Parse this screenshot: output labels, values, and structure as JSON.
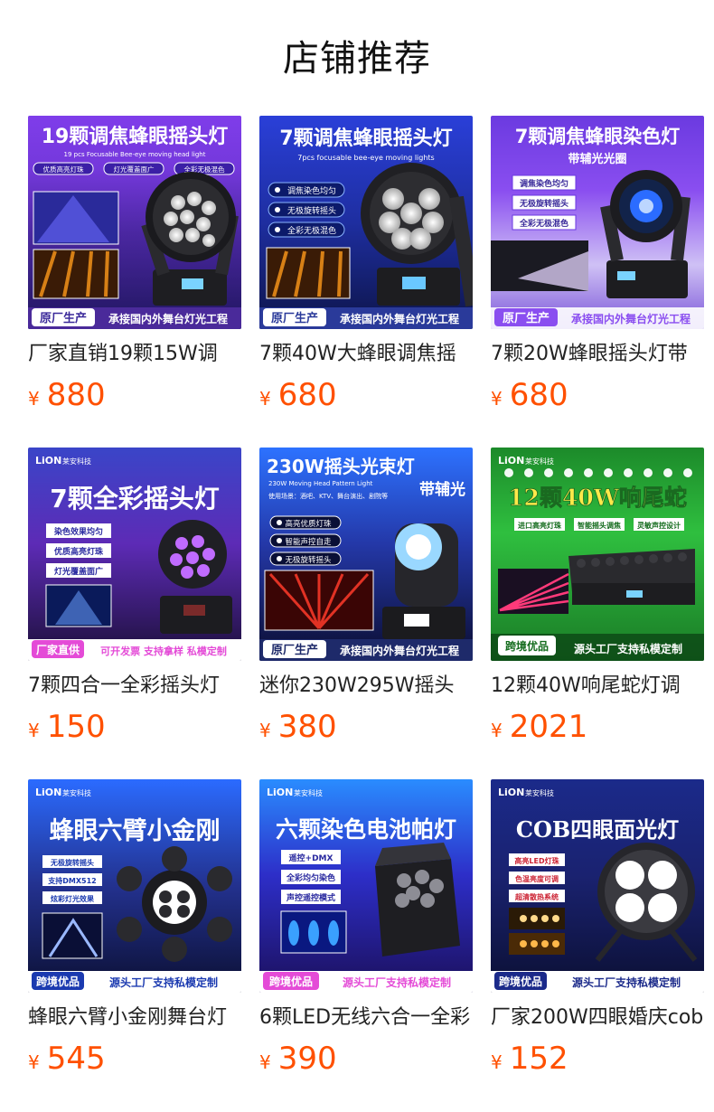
{
  "header": {
    "title": "店铺推荐"
  },
  "colors": {
    "price": "#ff5000",
    "text": "#222222"
  },
  "products": [
    {
      "title_full": "厂家直销19颗15W调",
      "price_currency": "¥",
      "price": "880",
      "image": {
        "headline": "19颗调焦蜂眼摇头灯",
        "subline": "19 pcs Focusable Bee-eye moving head light",
        "features": [
          "优质高亮灯珠",
          "灯光覆盖面广",
          "全彩无极混色"
        ],
        "badge": "原厂生产",
        "footer": "承接国内外舞台灯光工程"
      }
    },
    {
      "title_full": "7颗40W大蜂眼调焦摇",
      "price_currency": "¥",
      "price": "680",
      "image": {
        "headline": "7颗调焦蜂眼摇头灯",
        "subline": "7pcs focusable bee-eye moving lights",
        "features": [
          "调焦染色均匀",
          "无极旋转摇头",
          "全彩无极混色"
        ],
        "badge": "原厂生产",
        "footer": "承接国内外舞台灯光工程"
      }
    },
    {
      "title_full": "7颗20W蜂眼摇头灯带",
      "price_currency": "¥",
      "price": "680",
      "image": {
        "headline": "7颗调焦蜂眼染色灯",
        "subline": "带辅光光圈",
        "features": [
          "调焦染色均匀",
          "无极旋转摇头",
          "全彩无极混色"
        ],
        "badge": "原厂生产",
        "footer": "承接国内外舞台灯光工程"
      }
    },
    {
      "title_full": "7颗四合一全彩摇头灯",
      "price_currency": "¥",
      "price": "150",
      "image": {
        "logo": "LiON",
        "logo_text": "莱安科技",
        "headline": "7颗全彩摇头灯",
        "features": [
          "染色效果均匀",
          "优质高亮灯珠",
          "灯光覆盖面广"
        ],
        "badge": "厂家直供",
        "footer": "可开发票 支持拿样 私模定制"
      }
    },
    {
      "title_full": "迷你230W295W摇头",
      "price_currency": "¥",
      "price": "380",
      "image": {
        "headline": "230W摇头光束灯",
        "subline": "230W Moving Head Pattern Light",
        "extra": "带辅光",
        "usage": "使用场景：酒吧、KTV、舞台演出、剧院等",
        "features": [
          "高亮优质灯珠",
          "智能声控自走",
          "无极旋转摇头"
        ],
        "badge": "原厂生产",
        "footer": "承接国内外舞台灯光工程"
      }
    },
    {
      "title_full": "12颗40W响尾蛇灯调",
      "price_currency": "¥",
      "price": "2021",
      "image": {
        "logo": "LiON",
        "logo_text": "莱安科技",
        "headline": "12颗40W响尾蛇",
        "features": [
          "进口高亮灯珠",
          "智能摇头调焦",
          "灵敏声控设计"
        ],
        "badge": "跨境优品",
        "footer": "源头工厂支持私模定制"
      }
    },
    {
      "title_full": "蜂眼六臂小金刚舞台灯",
      "price_currency": "¥",
      "price": "545",
      "image": {
        "logo": "LiON",
        "logo_text": "莱安科技",
        "headline": "蜂眼六臂小金刚",
        "features": [
          "无极旋转摇头",
          "支持DMX512",
          "炫彩灯光效果"
        ],
        "badge": "跨境优品",
        "footer": "源头工厂支持私模定制"
      }
    },
    {
      "title_full": "6颗LED无线六合一全彩",
      "price_currency": "¥",
      "price": "390",
      "image": {
        "logo": "LiON",
        "logo_text": "莱安科技",
        "headline": "六颗染色电池帕灯",
        "features": [
          "遥控+DMX",
          "全彩均匀染色",
          "声控遥控模式"
        ],
        "badge": "跨境优品",
        "footer": "源头工厂支持私模定制"
      }
    },
    {
      "title_full": "厂家200W四眼婚庆cob",
      "price_currency": "¥",
      "price": "152",
      "image": {
        "logo": "LiON",
        "logo_text": "莱安科技",
        "headline": "COB四眼面光灯",
        "features": [
          "高亮LED灯珠",
          "色温亮度可调",
          "超清散热系统"
        ],
        "badge": "跨境优品",
        "footer": "源头工厂支持私模定制"
      }
    }
  ]
}
